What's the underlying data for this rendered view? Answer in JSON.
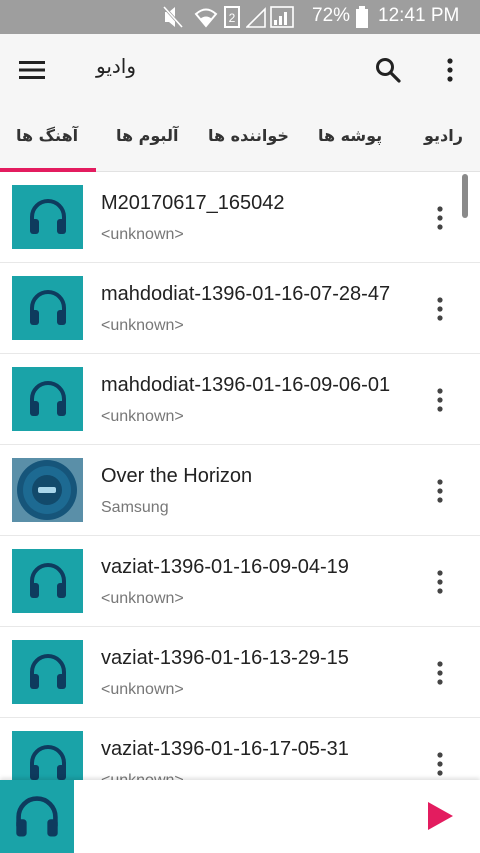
{
  "status_bar": {
    "battery": "72%",
    "time": "12:41 PM"
  },
  "app_bar": {
    "title": "وادیو",
    "menu_icon": "hamburger-menu-icon",
    "search_icon": "search-icon",
    "overflow_icon": "more-vert-icon"
  },
  "tabs": [
    {
      "label": "آهنگ ها",
      "selected": true
    },
    {
      "label": "آلبوم ها",
      "selected": false
    },
    {
      "label": "خواننده ها",
      "selected": false
    },
    {
      "label": "پوشه ها",
      "selected": false
    },
    {
      "label": "رادیو",
      "selected": false
    }
  ],
  "songs": [
    {
      "title": "M20170617_165042",
      "artist": "<unknown>",
      "art": "headphones-icon"
    },
    {
      "title": "mahdodiat-1396-01-16-07-28-47",
      "artist": "<unknown>",
      "art": "headphones-icon"
    },
    {
      "title": "mahdodiat-1396-01-16-09-06-01",
      "artist": "<unknown>",
      "art": "headphones-icon"
    },
    {
      "title": "Over the Horizon",
      "artist": "Samsung",
      "art": "album-art"
    },
    {
      "title": "vaziat-1396-01-16-09-04-19",
      "artist": "<unknown>",
      "art": "headphones-icon"
    },
    {
      "title": "vaziat-1396-01-16-13-29-15",
      "artist": "<unknown>",
      "art": "headphones-icon"
    },
    {
      "title": "vaziat-1396-01-16-17-05-31",
      "artist": "<unknown>",
      "art": "headphones-icon"
    }
  ],
  "mini_player": {
    "art": "headphones-icon",
    "play_icon": "play-icon"
  },
  "colors": {
    "accent": "#e31c5f",
    "thumb_bg": "#1aa3a8",
    "status_bar": "#9e9e9e",
    "app_bar": "#f6f6f6"
  }
}
